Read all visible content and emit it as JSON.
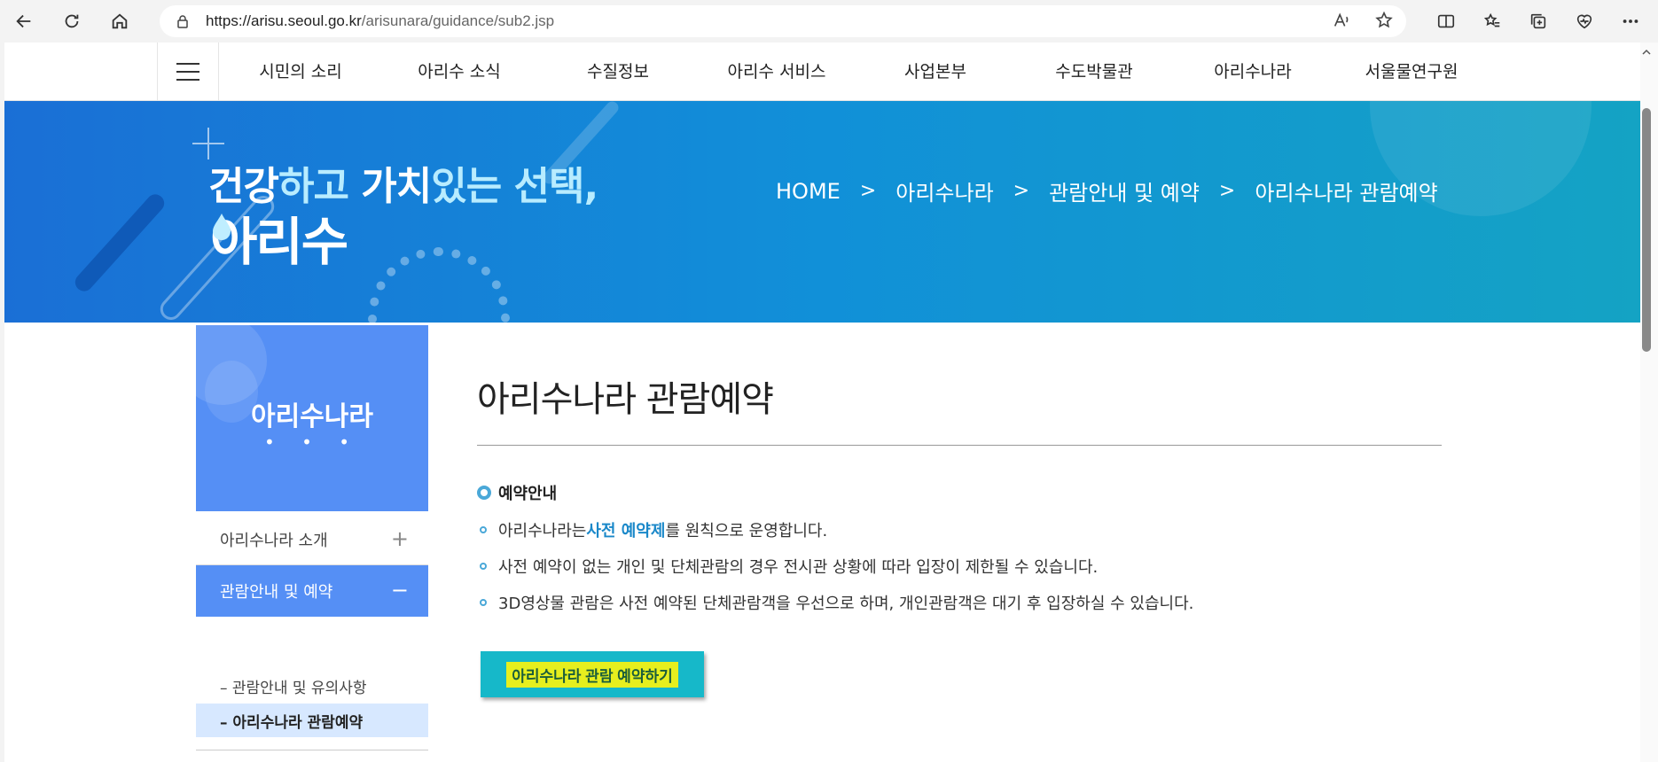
{
  "browser": {
    "url_host": "https://arisu.seoul.go.kr",
    "url_path": "/arisunara/guidance/sub2.jsp"
  },
  "gnb": {
    "items": [
      "시민의 소리",
      "아리수 소식",
      "수질정보",
      "아리수 서비스",
      "사업본부",
      "수도박물관",
      "아리수나라",
      "서울물연구원"
    ]
  },
  "banner": {
    "slogan_a": "건강",
    "slogan_b": "하고 ",
    "slogan_c": "가치",
    "slogan_d": "있는 선택,",
    "slogan_brand": "아리수",
    "breadcrumb": [
      "HOME",
      "아리수나라",
      "관람안내 및 예약",
      "아리수나라 관람예약"
    ],
    "breadcrumb_sep": ">"
  },
  "lnb": {
    "title": "아리수나라",
    "dots": "• • •",
    "item1": "아리수나라 소개",
    "item1_sign": "+",
    "item2": "관람안내 및 예약",
    "item2_sign": "−",
    "sub1": "–  관람안내 및 유의사항",
    "sub2": "–  아리수나라 관람예약"
  },
  "content": {
    "title": "아리수나라 관람예약",
    "section_title": "예약안내",
    "bullet1_pre": "아리수나라는 ",
    "bullet1_hl": "사전 예약제",
    "bullet1_post": "를 원칙으로 운영합니다.",
    "bullet2": "사전 예약이 없는 개인 및 단체관람의 경우 전시관 상황에 따라 입장이 제한될 수 있습니다.",
    "bullet3": "3D영상물 관람은 사전 예약된 단체관람객을 우선으로 하며, 개인관람객은 대기 후 입장하실 수 있습니다.",
    "reserve_button": "아리수나라 관람 예약하기"
  },
  "colors": {
    "accent_blue": "#558ff5",
    "highlight_blue": "#1a88c9",
    "button_teal": "#16b8c9",
    "button_highlight": "#e6ef1e"
  }
}
